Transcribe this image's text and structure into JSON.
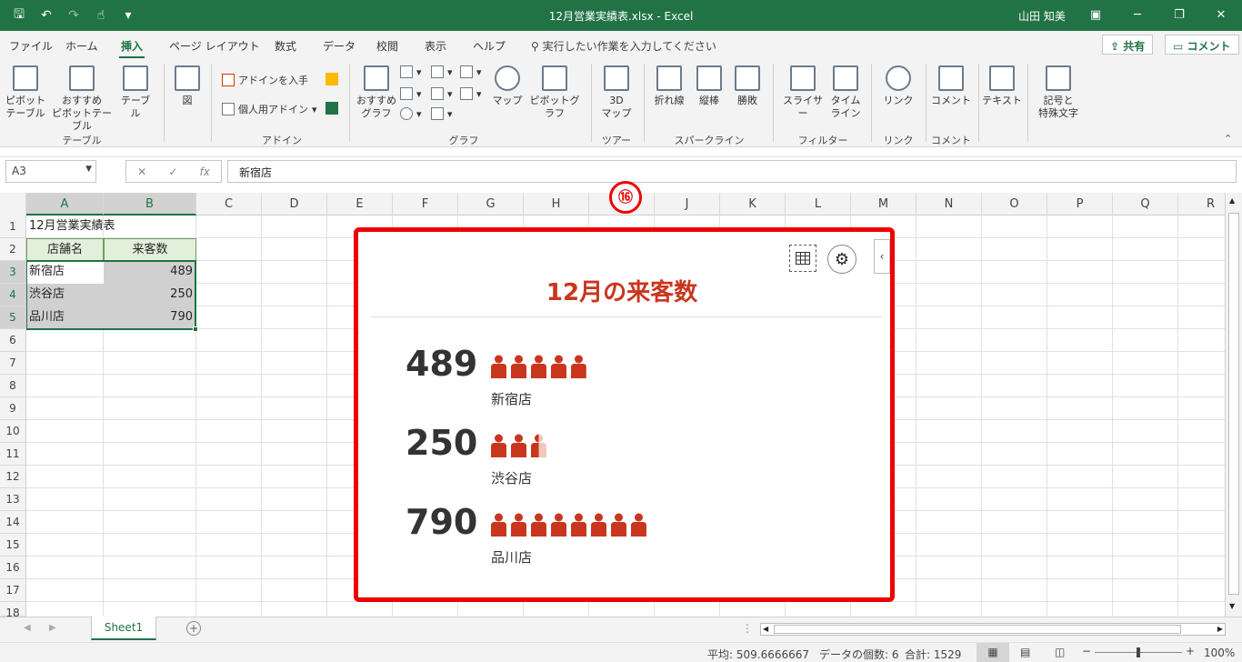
{
  "window": {
    "title": "12月営業実績表.xlsx  -  Excel",
    "user": "山田 知美",
    "qat": [
      "save-icon",
      "undo-icon",
      "redo-icon",
      "touch-icon",
      "customize-icon"
    ]
  },
  "menu": {
    "tabs": [
      "ファイル",
      "ホーム",
      "挿入",
      "ページ レイアウト",
      "数式",
      "データ",
      "校閲",
      "表示",
      "ヘルプ"
    ],
    "active": "挿入",
    "search": "実行したい作業を入力してください",
    "share": "共有",
    "comment": "コメント"
  },
  "ribbon": {
    "pivot": "ピボット\nテーブル",
    "recpivot": "おすすめ\nピボットテーブル",
    "table": "テーブル",
    "image": "図",
    "get_addin": "アドインを入手",
    "my_addin": "個人用アドイン",
    "recchart": "おすすめ\nグラフ",
    "map": "マップ",
    "pivotchart": "ピボットグラフ",
    "map3d": "3D\nマップ",
    "spark_line": "折れ線",
    "spark_col": "縦棒",
    "spark_wl": "勝敗",
    "slicer": "スライサー",
    "timeline": "タイム\nライン",
    "link": "リンク",
    "comment": "コメント",
    "text": "テキスト",
    "symbol": "記号と\n特殊文字",
    "groups": {
      "table": "テーブル",
      "addin": "アドイン",
      "chart": "グラフ",
      "tour": "ツアー",
      "sparkline": "スパークライン",
      "filter": "フィルター",
      "link": "リンク",
      "comment": "コメント"
    }
  },
  "formula": {
    "namebox": "A3",
    "value": "新宿店",
    "fx": "fx"
  },
  "columns": [
    "A",
    "B",
    "C",
    "D",
    "E",
    "F",
    "G",
    "H",
    "I",
    "J",
    "K",
    "L",
    "M",
    "N",
    "O",
    "P",
    "Q",
    "R"
  ],
  "rows": [
    "1",
    "2",
    "3",
    "4",
    "5",
    "6",
    "7",
    "8",
    "9",
    "10",
    "11",
    "12",
    "13",
    "14",
    "15",
    "16",
    "17",
    "18"
  ],
  "sheet": {
    "a1": "12月営業実績表",
    "hdr_a": "店舗名",
    "hdr_b": "来客数",
    "data": [
      {
        "name": "新宿店",
        "value": "489"
      },
      {
        "name": "渋谷店",
        "value": "250"
      },
      {
        "name": "品川店",
        "value": "790"
      }
    ]
  },
  "chart_data": {
    "type": "bar",
    "title": "12月の来客数",
    "categories": [
      "新宿店",
      "渋谷店",
      "品川店"
    ],
    "values": [
      489,
      250,
      790
    ],
    "icon_unit": 100,
    "color": "#c9361e"
  },
  "marker": "⑯",
  "tabs": {
    "sheet": "Sheet1"
  },
  "status": {
    "avg": "平均: 509.6666667",
    "count": "データの個数: 6",
    "sum": "合計: 1529",
    "zoom": "100%"
  }
}
